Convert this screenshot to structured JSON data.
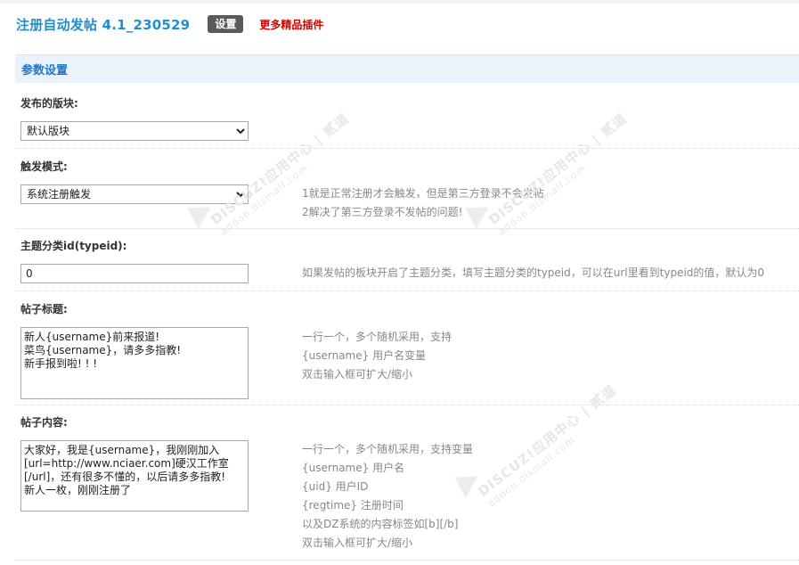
{
  "header": {
    "title": "注册自动发帖 4.1_230529",
    "settings_button": "设置",
    "more_plugins_link": "更多精品插件"
  },
  "section": {
    "title": "参数设置"
  },
  "fields": {
    "forum": {
      "label": "发布的版块:",
      "selected": "默认版块"
    },
    "trigger": {
      "label": "触发模式:",
      "selected": "系统注册触发",
      "help": [
        "1就是正常注册才会触发，但是第三方登录不会发帖",
        "2解决了第三方登录不发帖的问题!"
      ]
    },
    "typeid": {
      "label": "主题分类id(typeid):",
      "value": "0",
      "help": [
        "如果发帖的板块开启了主题分类，填写主题分类的typeid，可以在url里看到typeid的值，默认为0"
      ]
    },
    "post_title": {
      "label": "帖子标题:",
      "value": "新人{username}前来报道!\n菜鸟{username}，请多多指教!\n新手报到啦! ! !",
      "help": [
        "一行一个，多个随机采用，支持",
        "{username} 用户名变量",
        "双击输入框可扩大/缩小"
      ]
    },
    "post_content": {
      "label": "帖子内容:",
      "value": "大家好，我是{username}，我刚刚加入[url=http://www.nciaer.com]硬汉工作室[/url]，还有很多不懂的，以后请多多指教!\n新人一枚，刚刚注册了",
      "help": [
        "一行一个，多个随机采用，支持变量",
        "{username} 用户名",
        "{uid} 用户ID",
        "{regtime} 注册时间",
        "以及DZ系统的内容标签如[b][/b]",
        "双击输入框可扩大/缩小"
      ]
    }
  },
  "watermark": {
    "brand": "DISCUZ!应用中心 | 贰道",
    "domain": "addon.dismall.com"
  }
}
